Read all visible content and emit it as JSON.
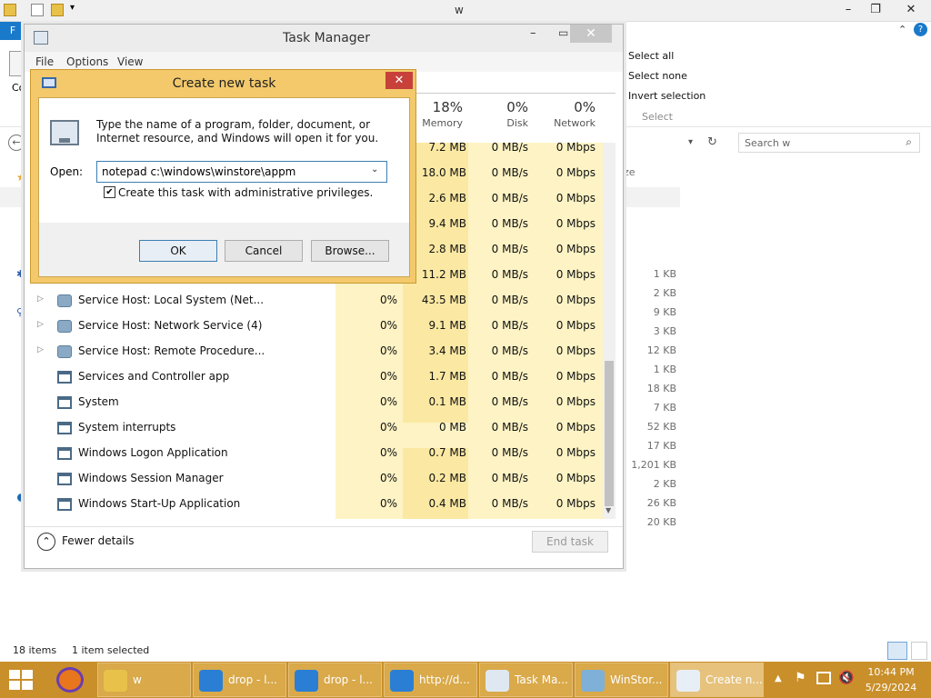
{
  "explorer": {
    "title": "w",
    "file_tab": "F",
    "ribbon": {
      "select_all": "Select all",
      "select_none": "Select none",
      "invert_selection": "Invert selection",
      "group": "Select",
      "left_label": "Co"
    },
    "search_placeholder": "Search w",
    "size_header": "ze",
    "sizes": [
      "1 KB",
      "2 KB",
      "9 KB",
      "3 KB",
      "12 KB",
      "1 KB",
      "18 KB",
      "7 KB",
      "52 KB",
      "17 KB",
      "1,201 KB",
      "2 KB",
      "26 KB",
      "20 KB"
    ],
    "status": {
      "items": "18 items",
      "selected": "1 item selected"
    }
  },
  "task_manager": {
    "title": "Task Manager",
    "menu": [
      "File",
      "Options",
      "View"
    ],
    "columns": [
      {
        "pct": "18%",
        "label": "Memory"
      },
      {
        "pct": "0%",
        "label": "Disk"
      },
      {
        "pct": "0%",
        "label": "Network"
      }
    ],
    "partial_rows": [
      {
        "mem": "7.2 MB",
        "disk": "0 MB/s",
        "net": "0 Mbps"
      },
      {
        "mem": "18.0 MB",
        "disk": "0 MB/s",
        "net": "0 Mbps"
      },
      {
        "mem": "2.6 MB",
        "disk": "0 MB/s",
        "net": "0 Mbps"
      },
      {
        "mem": "9.4 MB",
        "disk": "0 MB/s",
        "net": "0 Mbps"
      },
      {
        "mem": "2.8 MB",
        "disk": "0 MB/s",
        "net": "0 Mbps"
      },
      {
        "mem": "11.2 MB",
        "disk": "0 MB/s",
        "net": "0 Mbps"
      }
    ],
    "rows": [
      {
        "name": "Service Host: Local System (Net...",
        "icon": "gear",
        "expand": true,
        "cpu": "0%",
        "mem": "43.5 MB",
        "disk": "0 MB/s",
        "net": "0 Mbps"
      },
      {
        "name": "Service Host: Network Service (4)",
        "icon": "gear",
        "expand": true,
        "cpu": "0%",
        "mem": "9.1 MB",
        "disk": "0 MB/s",
        "net": "0 Mbps"
      },
      {
        "name": "Service Host: Remote Procedure...",
        "icon": "gear",
        "expand": true,
        "cpu": "0%",
        "mem": "3.4 MB",
        "disk": "0 MB/s",
        "net": "0 Mbps"
      },
      {
        "name": "Services and Controller app",
        "icon": "window",
        "expand": false,
        "cpu": "0%",
        "mem": "1.7 MB",
        "disk": "0 MB/s",
        "net": "0 Mbps"
      },
      {
        "name": "System",
        "icon": "window",
        "expand": false,
        "cpu": "0%",
        "mem": "0.1 MB",
        "disk": "0 MB/s",
        "net": "0 Mbps"
      },
      {
        "name": "System interrupts",
        "icon": "window",
        "expand": false,
        "cpu": "0%",
        "mem": "0 MB",
        "disk": "0 MB/s",
        "net": "0 Mbps"
      },
      {
        "name": "Windows Logon Application",
        "icon": "window",
        "expand": false,
        "cpu": "0%",
        "mem": "0.7 MB",
        "disk": "0 MB/s",
        "net": "0 Mbps"
      },
      {
        "name": "Windows Session Manager",
        "icon": "window",
        "expand": false,
        "cpu": "0%",
        "mem": "0.2 MB",
        "disk": "0 MB/s",
        "net": "0 Mbps"
      },
      {
        "name": "Windows Start-Up Application",
        "icon": "window",
        "expand": false,
        "cpu": "0%",
        "mem": "0.4 MB",
        "disk": "0 MB/s",
        "net": "0 Mbps"
      }
    ],
    "fewer_details": "Fewer details",
    "end_task": "End task"
  },
  "dialog": {
    "title": "Create new task",
    "description": "Type the name of a program, folder, document, or Internet resource, and Windows will open it for you.",
    "open_label": "Open:",
    "open_value": "notepad c:\\windows\\winstore\\appm",
    "admin_label": "Create this task with administrative privileges.",
    "admin_checked": true,
    "ok": "OK",
    "cancel": "Cancel",
    "browse": "Browse..."
  },
  "taskbar": {
    "items": [
      {
        "label": "w",
        "icon": "folder-icon"
      },
      {
        "label": "drop - l...",
        "icon": "ie-icon"
      },
      {
        "label": "drop - l...",
        "icon": "ie-icon"
      },
      {
        "label": "http://d...",
        "icon": "ie-icon"
      },
      {
        "label": "Task Ma...",
        "icon": "task-manager-icon"
      },
      {
        "label": "WinStor...",
        "icon": "winstore-icon"
      },
      {
        "label": "Create n...",
        "icon": "run-icon"
      }
    ],
    "time": "10:44 PM",
    "date": "5/29/2024"
  },
  "colors": {
    "taskbar": "#c98f2a",
    "dialog_frame": "#f3c96b",
    "accent_blue": "#1979ca",
    "highlight_column": "#fdf3c4"
  }
}
